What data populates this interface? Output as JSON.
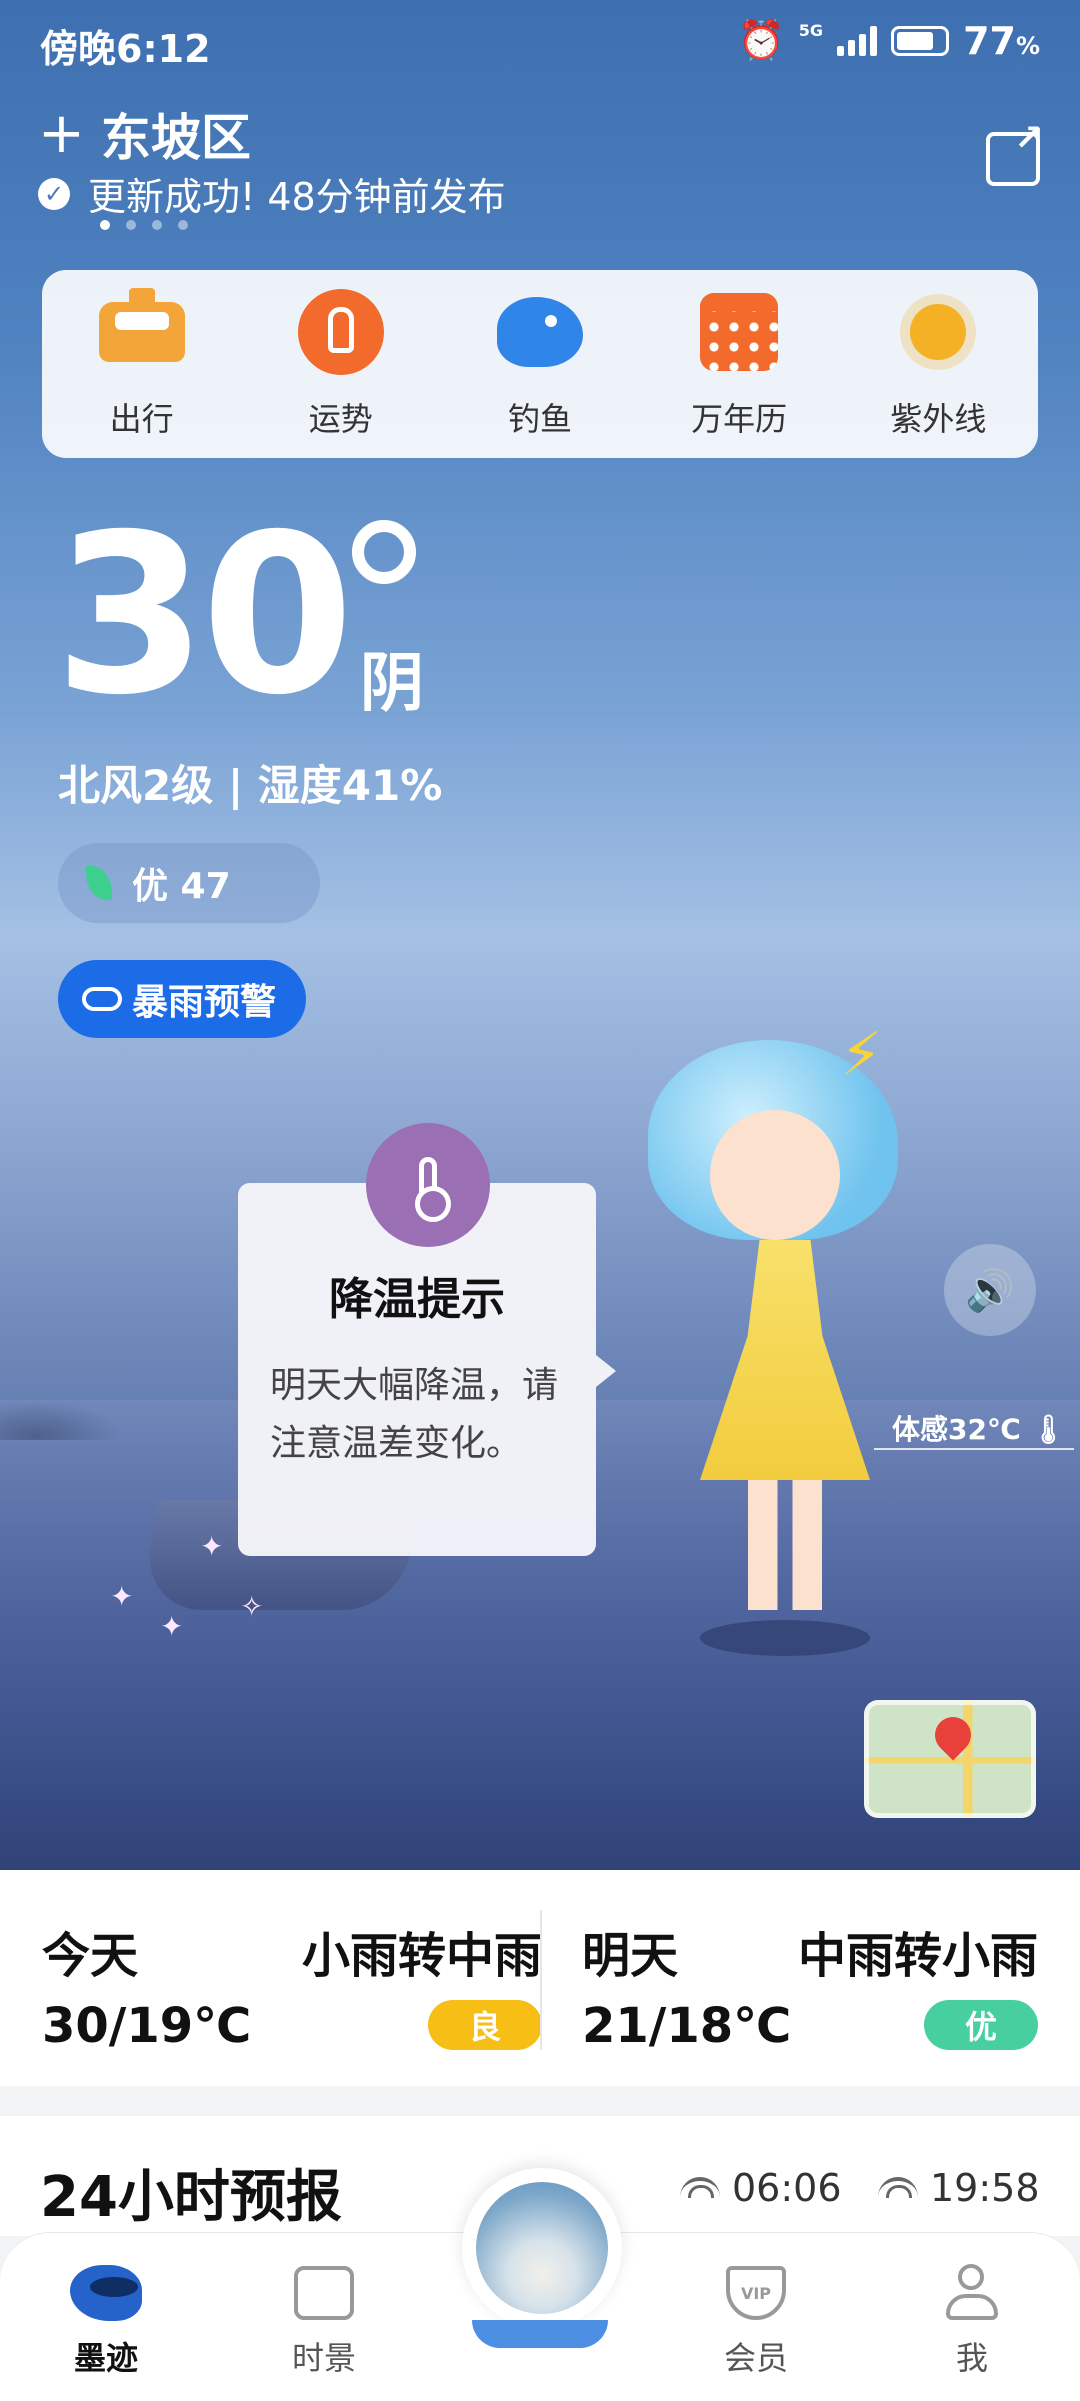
{
  "status_bar": {
    "time": "傍晚6:12",
    "network": "5G",
    "battery": "77",
    "battery_unit": "%"
  },
  "location": {
    "name": "东坡区",
    "update_text": "更新成功! 48分钟前发布"
  },
  "quick_actions": [
    {
      "label": "出行",
      "icon": "taxi-icon"
    },
    {
      "label": "运势",
      "icon": "fortune-icon"
    },
    {
      "label": "钓鱼",
      "icon": "fish-icon"
    },
    {
      "label": "万年历",
      "icon": "calendar-icon"
    },
    {
      "label": "紫外线",
      "icon": "sun-icon"
    }
  ],
  "current": {
    "temperature": "30",
    "condition": "阴",
    "wind_humidity": "北风2级 | 湿度41%",
    "aqi": "优 47",
    "alert": "暴雨预警",
    "feels_like": "体感32℃"
  },
  "tip": {
    "title": "降温提示",
    "text": "明天大幅降温，请注意温差变化。"
  },
  "forecast": {
    "today": {
      "label": "今天",
      "weather": "小雨转中雨",
      "range": "30/19℃",
      "aqi": "良",
      "aqi_color": "#f7be16"
    },
    "tomorrow": {
      "label": "明天",
      "weather": "中雨转小雨",
      "range": "21/18℃",
      "aqi": "优",
      "aqi_color": "#47cfa0"
    }
  },
  "hourly": {
    "title": "24小时预报",
    "sunrise": "06:06",
    "sunset": "19:58"
  },
  "nav": [
    {
      "label": "墨迹",
      "icon": "moji-icon",
      "active": true
    },
    {
      "label": "时景",
      "icon": "image-icon",
      "active": false
    },
    {
      "label": "会员",
      "icon": "vip-icon",
      "active": false
    },
    {
      "label": "我",
      "icon": "user-icon",
      "active": false
    }
  ],
  "colors": {
    "hero_top": "#3e6fb0",
    "alert_blue": "#1c6ce8",
    "tip_purple": "#9a6fb4"
  }
}
